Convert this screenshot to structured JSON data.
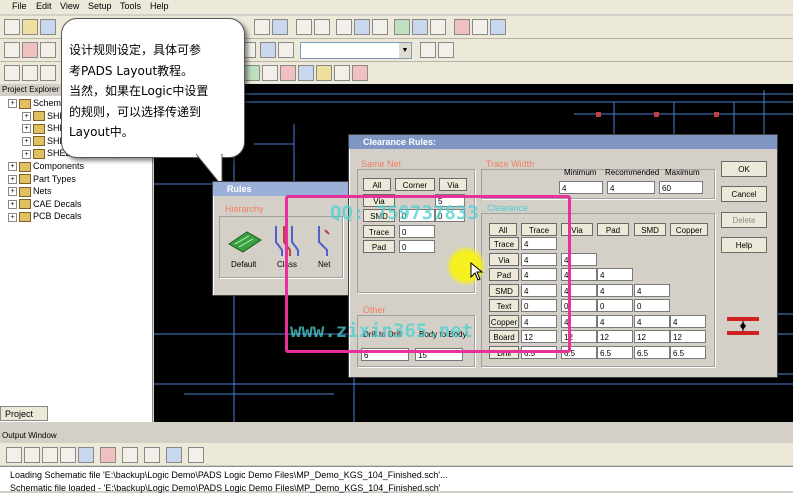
{
  "menu": [
    "File",
    "Edit",
    "View",
    "Setup",
    "Tools",
    "Help"
  ],
  "project_explorer": {
    "title": "Project Explorer",
    "items": [
      {
        "label": "Schematic",
        "indent": 0
      },
      {
        "label": "SHEET1",
        "indent": 1
      },
      {
        "label": "SHEET2",
        "indent": 1
      },
      {
        "label": "SHEET3",
        "indent": 1
      },
      {
        "label": "SHEET4_AUDIO_POWER",
        "indent": 1
      },
      {
        "label": "Components",
        "indent": 0
      },
      {
        "label": "Part Types",
        "indent": 0
      },
      {
        "label": "Nets",
        "indent": 0
      },
      {
        "label": "CAE Decals",
        "indent": 0
      },
      {
        "label": "PCB Decals",
        "indent": 0
      }
    ],
    "tab": "Project"
  },
  "bubble": {
    "lines": [
      "设计规则设定，具体可参",
      "考PADS  Layout教程。",
      "当然，如果在Logic中设置",
      "的规则，可以选择传递到",
      "Layout中。"
    ]
  },
  "rules_dialog": {
    "title": "Rules",
    "group": "Hierarchy",
    "buttons": [
      "Default",
      "Class",
      "Net"
    ]
  },
  "clearance_dialog": {
    "title": "Clearance Rules:",
    "same_net": {
      "title": "Same Net",
      "buttons": [
        "All",
        "Corner",
        "Via"
      ],
      "via_label": "Via",
      "via_value": "5",
      "rows": [
        {
          "label": "SMD",
          "values": [
            "0",
            "0"
          ]
        },
        {
          "label": "Trace",
          "values": [
            "0"
          ]
        },
        {
          "label": "Pad",
          "values": [
            "0"
          ]
        }
      ]
    },
    "trace_width": {
      "title": "Trace Width",
      "headers": [
        "Minimum",
        "Recommended",
        "Maximum"
      ],
      "values": [
        "4",
        "4",
        "60"
      ]
    },
    "clearance": {
      "title": "Clearance",
      "columns": [
        "All",
        "Trace",
        "Via",
        "Pad",
        "SMD",
        "Copper"
      ],
      "rows": [
        {
          "label": "Trace",
          "values": [
            "4"
          ]
        },
        {
          "label": "Via",
          "values": [
            "4",
            "4"
          ]
        },
        {
          "label": "Pad",
          "values": [
            "4",
            "4",
            "4"
          ]
        },
        {
          "label": "SMD",
          "values": [
            "4",
            "4",
            "4",
            "4"
          ]
        },
        {
          "label": "Text",
          "values": [
            "0",
            "0",
            "0",
            "0"
          ]
        },
        {
          "label": "Copper",
          "values": [
            "4",
            "4",
            "4",
            "4",
            "4"
          ]
        },
        {
          "label": "Board",
          "values": [
            "12",
            "12",
            "12",
            "12",
            "12"
          ]
        },
        {
          "label": "Drill",
          "values": [
            "6.5",
            "6.5",
            "6.5",
            "6.5",
            "6.5"
          ]
        }
      ]
    },
    "other": {
      "title": "Other",
      "labels": [
        "Drill to Drill",
        "Body to Body"
      ],
      "values": [
        "6",
        "15"
      ]
    },
    "side_buttons": [
      "OK",
      "Cancel",
      "Delete",
      "Help"
    ]
  },
  "watermark": {
    "qq": "QQ: 759737833",
    "url": "www.zixin365.net"
  },
  "output_window": {
    "title": "Output Window",
    "lines": [
      "Loading Schematic file 'E:\\backup\\Logic Demo\\PADS Logic Demo Files\\MP_Demo_KGS_104_Finished.sch'...",
      "Schematic file loaded - 'E:\\backup\\Logic Demo\\PADS Logic Demo Files\\MP_Demo_KGS_104_Finished.sch'"
    ]
  },
  "colors": {
    "watermark": "#4ecfd2",
    "highlight_box": "#e8309a",
    "schematic_wire": "#4a7fd0",
    "group_title": "#f08060"
  }
}
